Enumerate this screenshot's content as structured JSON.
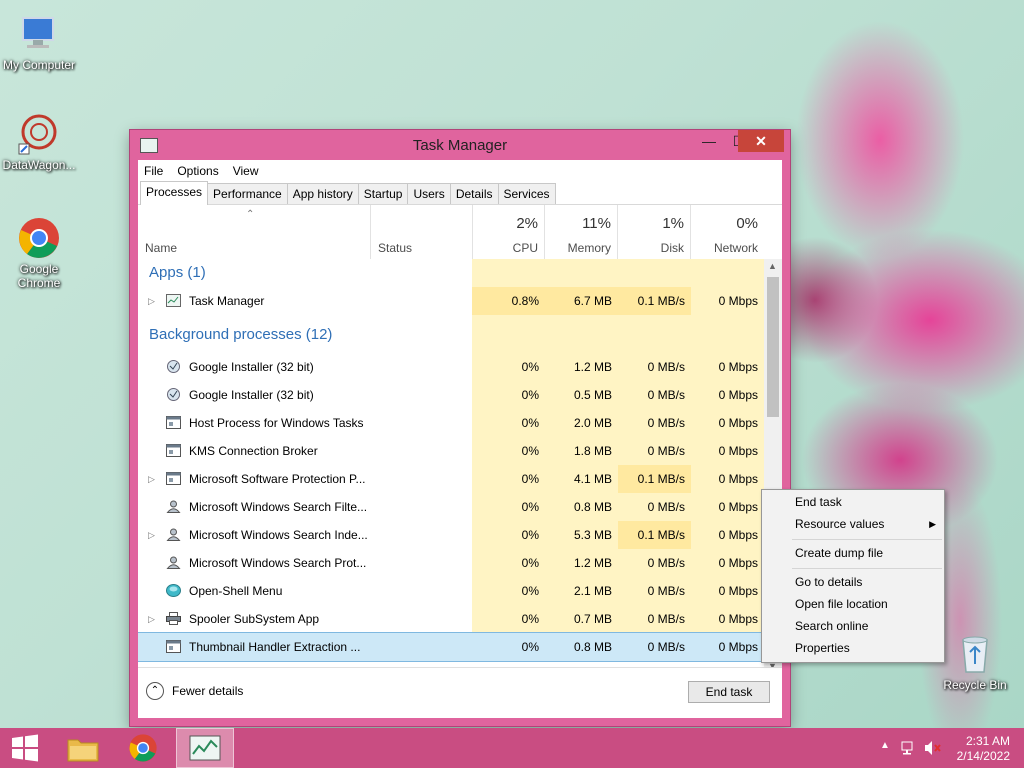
{
  "desktop": {
    "icons": [
      {
        "label": "My Computer"
      },
      {
        "label": "DataWagon..."
      },
      {
        "label": "Google Chrome"
      },
      {
        "label": "Recycle Bin"
      }
    ]
  },
  "window": {
    "title": "Task Manager",
    "buttons": {
      "minimize": "—",
      "maximize": "☐",
      "close": "✕"
    },
    "menu": [
      "File",
      "Options",
      "View"
    ],
    "tabs": [
      "Processes",
      "Performance",
      "App history",
      "Startup",
      "Users",
      "Details",
      "Services"
    ],
    "columns": {
      "name": "Name",
      "status": "Status",
      "cpu": {
        "pct": "2%",
        "label": "CPU"
      },
      "memory": {
        "pct": "11%",
        "label": "Memory"
      },
      "disk": {
        "pct": "1%",
        "label": "Disk"
      },
      "network": {
        "pct": "0%",
        "label": "Network"
      }
    },
    "groups": {
      "apps": "Apps (1)",
      "background": "Background processes (12)"
    },
    "apps": [
      {
        "name": "Task Manager",
        "cpu": "0.8%",
        "mem": "6.7 MB",
        "disk": "0.1 MB/s",
        "net": "0 Mbps"
      }
    ],
    "background": [
      {
        "name": "Google Installer (32 bit)",
        "cpu": "0%",
        "mem": "1.2 MB",
        "disk": "0 MB/s",
        "net": "0 Mbps"
      },
      {
        "name": "Google Installer (32 bit)",
        "cpu": "0%",
        "mem": "0.5 MB",
        "disk": "0 MB/s",
        "net": "0 Mbps"
      },
      {
        "name": "Host Process for Windows Tasks",
        "cpu": "0%",
        "mem": "2.0 MB",
        "disk": "0 MB/s",
        "net": "0 Mbps"
      },
      {
        "name": "KMS Connection Broker",
        "cpu": "0%",
        "mem": "1.8 MB",
        "disk": "0 MB/s",
        "net": "0 Mbps"
      },
      {
        "name": "Microsoft Software Protection P...",
        "cpu": "0%",
        "mem": "4.1 MB",
        "disk": "0.1 MB/s",
        "net": "0 Mbps"
      },
      {
        "name": "Microsoft Windows Search Filte...",
        "cpu": "0%",
        "mem": "0.8 MB",
        "disk": "0 MB/s",
        "net": "0 Mbps"
      },
      {
        "name": "Microsoft Windows Search Inde...",
        "cpu": "0%",
        "mem": "5.3 MB",
        "disk": "0.1 MB/s",
        "net": "0 Mbps"
      },
      {
        "name": "Microsoft Windows Search Prot...",
        "cpu": "0%",
        "mem": "1.2 MB",
        "disk": "0 MB/s",
        "net": "0 Mbps"
      },
      {
        "name": "Open-Shell Menu",
        "cpu": "0%",
        "mem": "2.1 MB",
        "disk": "0 MB/s",
        "net": "0 Mbps"
      },
      {
        "name": "Spooler SubSystem App",
        "cpu": "0%",
        "mem": "0.7 MB",
        "disk": "0 MB/s",
        "net": "0 Mbps"
      },
      {
        "name": "Thumbnail Handler Extraction ...",
        "cpu": "0%",
        "mem": "0.8 MB",
        "disk": "0 MB/s",
        "net": "0 Mbps"
      }
    ],
    "fewer_details": "Fewer details",
    "end_task": "End task"
  },
  "context_menu": {
    "items": [
      "End task",
      "Resource values",
      "Create dump file",
      "Go to details",
      "Open file location",
      "Search online",
      "Properties"
    ]
  },
  "taskbar": {
    "time": "2:31 AM",
    "date": "2/14/2022"
  },
  "colors": {
    "accent": "#e0649e",
    "taskbar": "#c94d82",
    "group_text": "#2f6fb6",
    "heat": "#fff4c4"
  }
}
